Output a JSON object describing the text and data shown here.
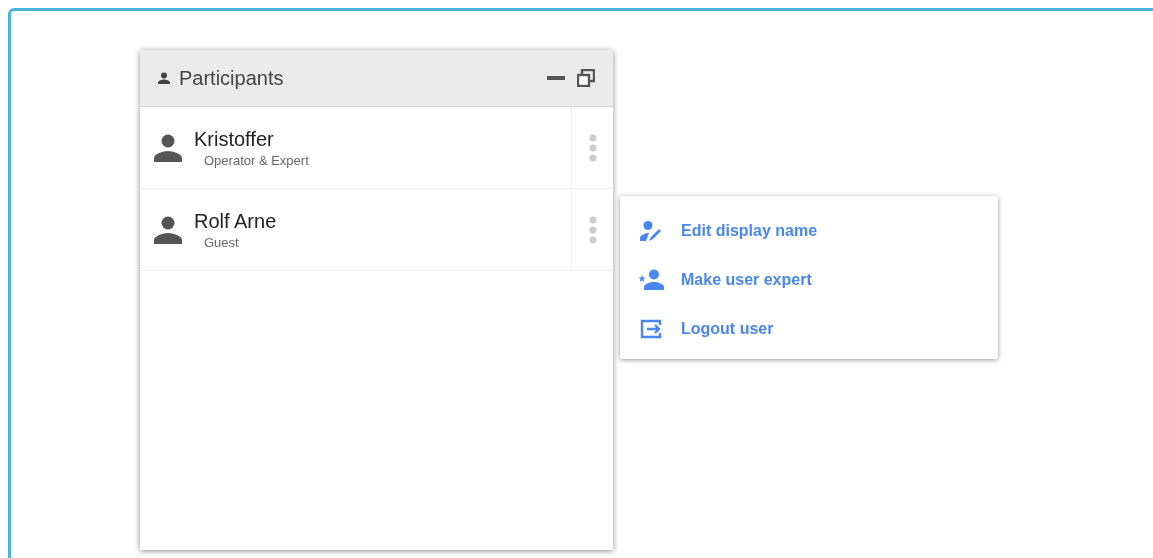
{
  "panel": {
    "title": "Participants"
  },
  "participants": [
    {
      "name": "Kristoffer",
      "role": "Operator & Expert"
    },
    {
      "name": "Rolf Arne",
      "role": "Guest"
    }
  ],
  "context_menu": {
    "items": [
      {
        "kind": "edit",
        "label": "Edit display name"
      },
      {
        "kind": "expert",
        "label": "Make user expert"
      },
      {
        "kind": "logout",
        "label": "Logout user"
      }
    ]
  }
}
